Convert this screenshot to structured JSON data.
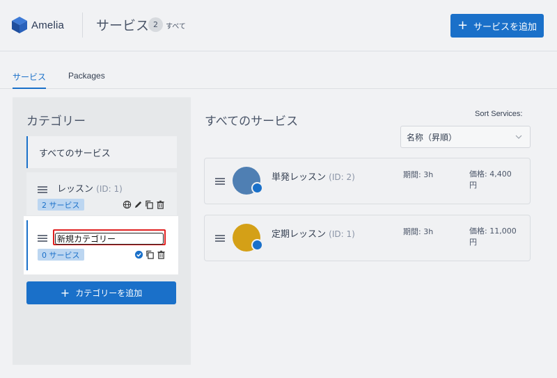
{
  "header": {
    "logo_text": "Amelia",
    "title": "サービス",
    "count": "2",
    "count_label": "すべて",
    "add_service_label": "サービスを追加"
  },
  "tabs": [
    {
      "label": "サービス",
      "active": true
    },
    {
      "label": "Packages",
      "active": false
    }
  ],
  "categories": {
    "title": "カテゴリー",
    "all_label": "すべてのサービス",
    "items": [
      {
        "name": "レッスン",
        "id_text": "(ID: 1)",
        "services_badge": "2 サービス"
      }
    ],
    "editing": {
      "input_value": "新規カテゴリー",
      "services_badge": "0 サービス"
    },
    "add_category_label": "カテゴリーを追加"
  },
  "services": {
    "title": "すべてのサービス",
    "sort_label": "Sort Services:",
    "sort_value": "名称（昇順）",
    "items": [
      {
        "name": "単発レッスン",
        "id_text": "(ID: 2)",
        "duration": "期間: 3h",
        "price": "価格: 4,400 円",
        "image_color": "#4f7fb3"
      },
      {
        "name": "定期レッスン",
        "id_text": "(ID: 1)",
        "duration": "期間: 3h",
        "price": "価格: 11,000 円",
        "image_color": "#d4a017"
      }
    ]
  },
  "colors": {
    "accent": "#1a70c9",
    "highlight_border": "#e02020"
  }
}
